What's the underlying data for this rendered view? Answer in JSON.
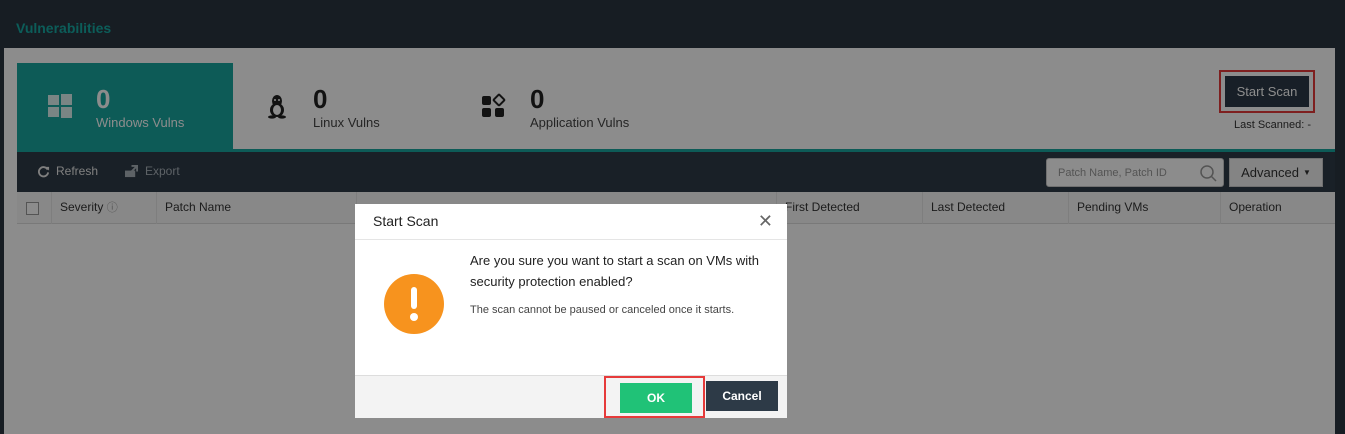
{
  "header": {
    "title": "Vulnerabilities"
  },
  "stats": [
    {
      "count": "0",
      "label": "Windows Vulns",
      "icon": "windows-icon"
    },
    {
      "count": "0",
      "label": "Linux Vulns",
      "icon": "linux-icon"
    },
    {
      "count": "0",
      "label": "Application Vulns",
      "icon": "application-icon"
    }
  ],
  "actions": {
    "start_scan": "Start Scan",
    "last_scanned": "Last Scanned: -"
  },
  "toolbar": {
    "refresh": "Refresh",
    "export": "Export",
    "search_placeholder": "Patch Name, Patch ID",
    "advanced": "Advanced"
  },
  "table": {
    "columns": [
      "Severity",
      "Patch Name",
      "First Detected",
      "Last Detected",
      "Pending VMs",
      "Operation"
    ]
  },
  "modal": {
    "title": "Start Scan",
    "message": "Are you sure you want to start a scan on VMs with security protection enabled?",
    "note": "The scan cannot be paused or canceled once it starts.",
    "ok": "OK",
    "cancel": "Cancel"
  },
  "colors": {
    "accent": "#19a69f",
    "ok": "#20c277",
    "dark": "#2d3a47",
    "warning": "#f7931e",
    "highlight": "#e63a3a"
  }
}
